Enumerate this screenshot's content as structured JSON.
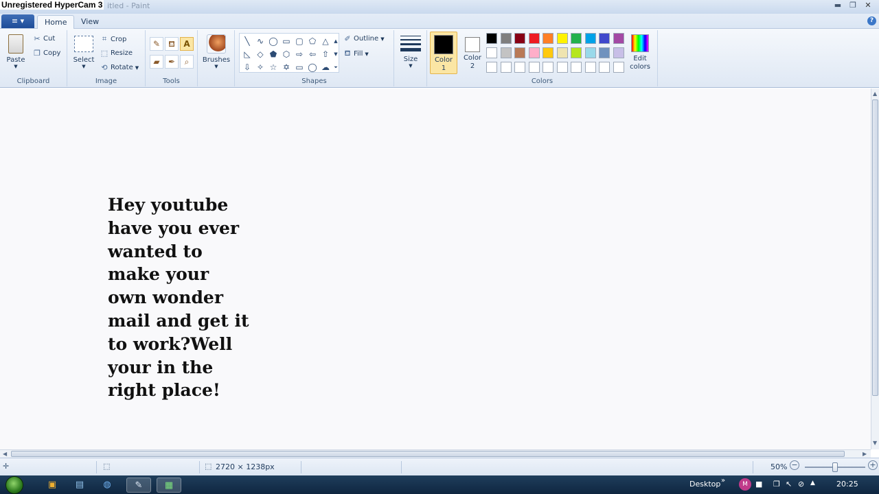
{
  "watermark": "Unregistered HyperCam 3",
  "window": {
    "title": "Untitled - Paint",
    "title_visible": "itled - Paint"
  },
  "menu": {
    "app_button": "≡ ▾",
    "tabs": [
      {
        "label": "Home"
      },
      {
        "label": "View"
      }
    ]
  },
  "ribbon": {
    "clipboard": {
      "label": "Clipboard",
      "paste": "Paste",
      "cut": "Cut",
      "copy": "Copy"
    },
    "image": {
      "label": "Image",
      "select": "Select",
      "crop": "Crop",
      "resize": "Resize",
      "rotate": "Rotate"
    },
    "tools": {
      "label": "Tools"
    },
    "brushes": {
      "label": "Brushes"
    },
    "shapes": {
      "label": "Shapes",
      "outline": "Outline",
      "fill": "Fill"
    },
    "size": {
      "label": "Size"
    },
    "colors": {
      "label": "Colors",
      "color1_label": "Color 1",
      "color2_label": "Color 2",
      "edit_colors": "Edit colors",
      "color1": "#000000",
      "color2": "#ffffff",
      "palette_row1": [
        "#000000",
        "#7f7f7f",
        "#880015",
        "#ed1c24",
        "#ff7f27",
        "#fff200",
        "#22b14c",
        "#00a2e8",
        "#3f48cc",
        "#a349a4"
      ],
      "palette_row2": [
        "#ffffff",
        "#c3c3c3",
        "#b97a57",
        "#ffaec9",
        "#ffc90e",
        "#efe4b0",
        "#b5e61d",
        "#99d9ea",
        "#7092be",
        "#c8bfe7"
      ],
      "palette_row3": [
        "#ffffff",
        "#ffffff",
        "#ffffff",
        "#ffffff",
        "#ffffff",
        "#ffffff",
        "#ffffff",
        "#ffffff",
        "#ffffff",
        "#ffffff"
      ]
    }
  },
  "canvas": {
    "text": "Hey youtube\nhave you ever\nwanted to\nmake your\nown wonder\nmail and get it\nto work?Well\nyour in the\nright place!"
  },
  "status": {
    "image_size": "2720 × 1238px",
    "zoom": "50%",
    "zoom_level_fraction": 0.5
  },
  "taskbar": {
    "desktop_label": "Desktop",
    "clock": "20:25"
  }
}
